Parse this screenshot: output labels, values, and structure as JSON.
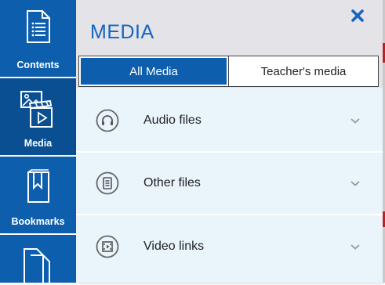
{
  "sidebar": {
    "items": [
      {
        "label": "Contents",
        "icon": "document-list-icon"
      },
      {
        "label": "Media",
        "icon": "media-icon",
        "active": true
      },
      {
        "label": "Bookmarks",
        "icon": "bookmark-icon"
      },
      {
        "label": "",
        "icon": "pages-icon"
      }
    ]
  },
  "panel": {
    "title": "MEDIA",
    "close_icon": "close-icon",
    "tabs": [
      {
        "label": "All Media",
        "selected": true
      },
      {
        "label": "Teacher's media",
        "selected": false
      }
    ],
    "rows": [
      {
        "label": "Audio files",
        "icon": "headphones-icon"
      },
      {
        "label": "Other files",
        "icon": "file-icon"
      },
      {
        "label": "Video links",
        "icon": "film-icon"
      }
    ]
  },
  "colors": {
    "rail": "#0d5fae",
    "accent": "#1565c0",
    "panel_bg": "#e9f4fb",
    "header_bg": "#e3e3e8"
  }
}
